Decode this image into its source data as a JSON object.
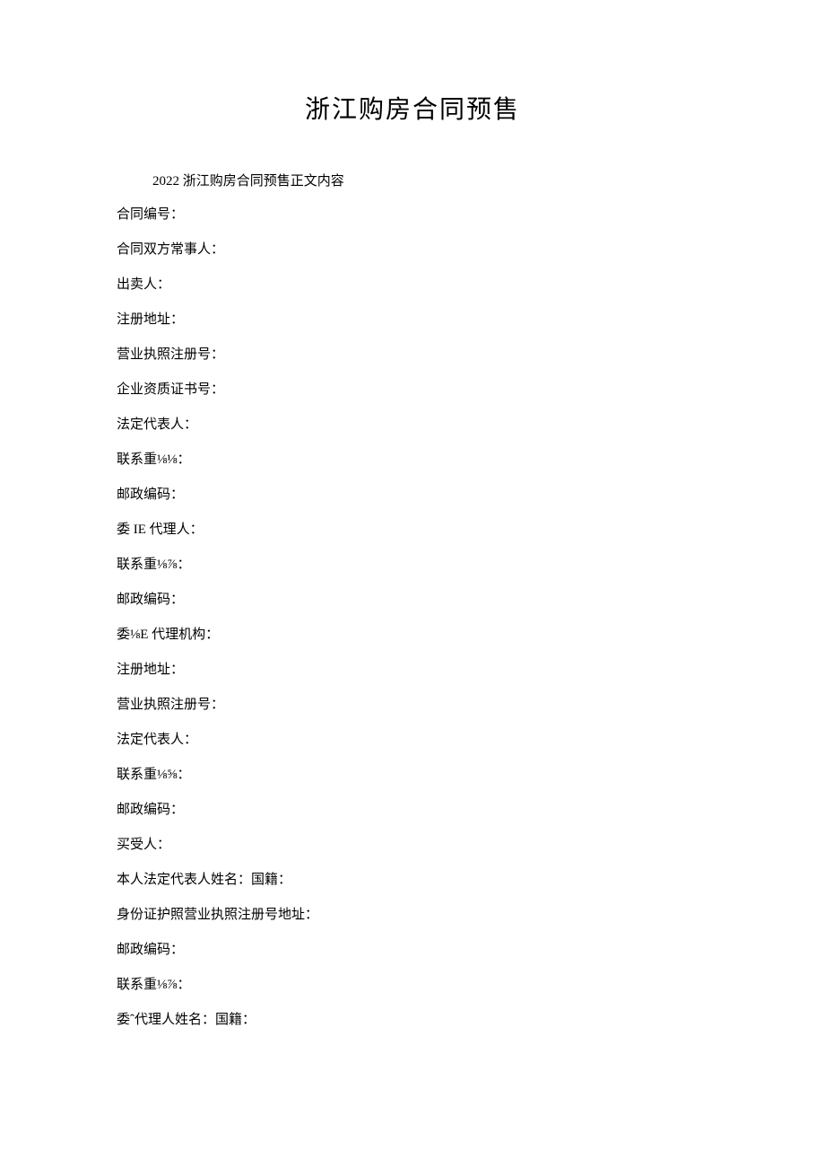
{
  "title": "浙江购房合同预售",
  "intro": "2022 浙江购房合同预售正文内容",
  "fields": [
    "合同编号：",
    "合同双方常事人：",
    "出卖人：",
    "注册地址：",
    "营业执照注册号：",
    "企业资质证书号：",
    "法定代表人：",
    "联系重⅛⅛：",
    "邮政编码：",
    "委 IE 代理人：",
    "联系重⅛⅞：",
    "邮政编码：",
    "委⅛E 代理机构：",
    "注册地址：",
    "营业执照注册号：",
    "法定代表人：",
    "联系重⅛⅝：",
    "邮政编码：",
    "买受人：",
    "本人法定代表人姓名：国籍：",
    "身份证护照营业执照注册号地址：",
    "邮政编码：",
    "联系重⅛⅞：",
    "委ˆ代理人姓名：国籍："
  ]
}
